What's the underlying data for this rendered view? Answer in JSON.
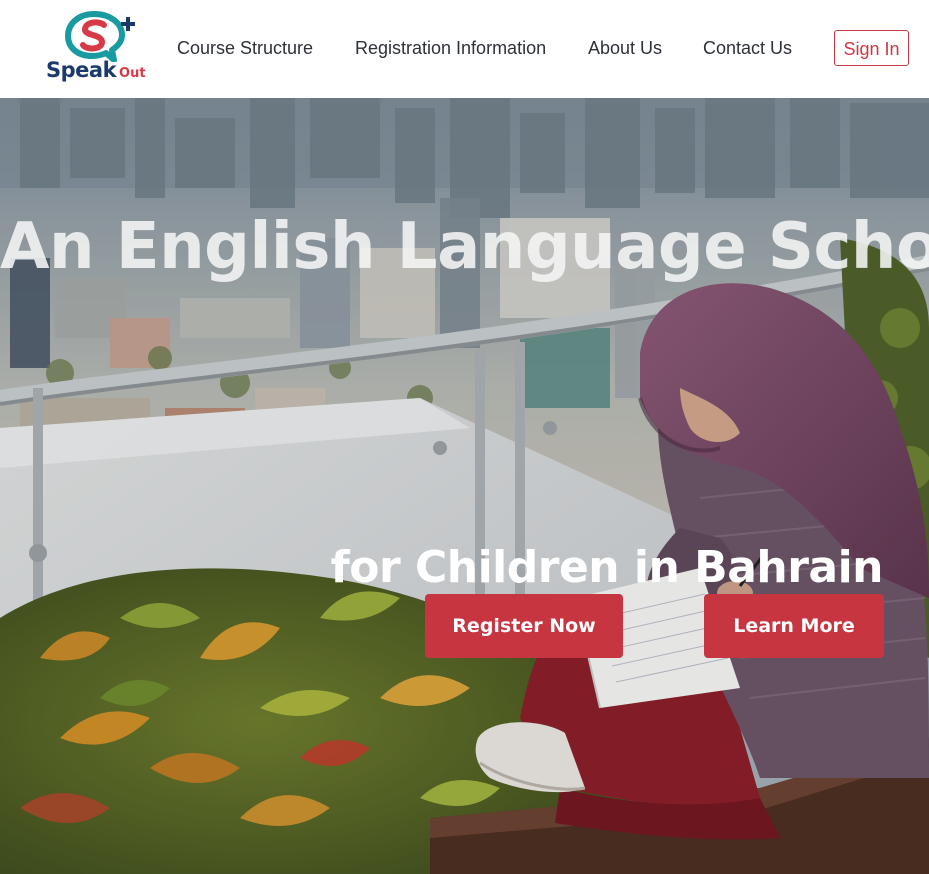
{
  "brand": {
    "logo_speak": "Speak",
    "logo_out": "Out",
    "logo_icon": "speech-bubble-s-plus-icon",
    "colors": {
      "navy": "#1b3a6b",
      "teal": "#1a9aa1",
      "red": "#d63a47"
    }
  },
  "nav": {
    "items": [
      {
        "label": "Course Structure"
      },
      {
        "label": "Registration Information"
      },
      {
        "label": "About Us"
      },
      {
        "label": "Contact Us"
      }
    ],
    "signin_label": "Sign In"
  },
  "hero": {
    "title": "An English Language School",
    "subtitle": "for Children in Bahrain",
    "background_image": "girl in purple hijab writing in notebook on rooftop terrace with plants, city skyline behind",
    "buttons": {
      "register_label": "Register Now",
      "learn_label": "Learn More"
    }
  },
  "colors": {
    "accent": "#c63540",
    "nav_text": "#2d3138",
    "header_bg": "#ffffff"
  }
}
